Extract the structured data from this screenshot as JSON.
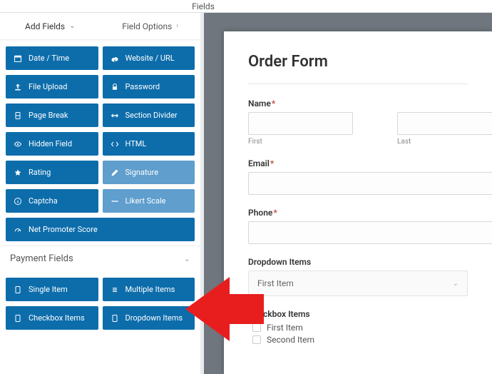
{
  "top": {
    "title": "Fields"
  },
  "tabs": {
    "add": "Add Fields",
    "options": "Field Options"
  },
  "fields": [
    {
      "icon": "cal",
      "label": "Date / Time"
    },
    {
      "icon": "link",
      "label": "Website / URL"
    },
    {
      "icon": "up",
      "label": "File Upload"
    },
    {
      "icon": "lock",
      "label": "Password"
    },
    {
      "icon": "page",
      "label": "Page Break"
    },
    {
      "icon": "div",
      "label": "Section Divider"
    },
    {
      "icon": "eye",
      "label": "Hidden Field"
    },
    {
      "icon": "code",
      "label": "HTML"
    },
    {
      "icon": "star",
      "label": "Rating"
    },
    {
      "icon": "pen",
      "label": "Signature"
    },
    {
      "icon": "info",
      "label": "Captcha"
    },
    {
      "icon": "lik",
      "label": "Likert Scale"
    },
    {
      "icon": "gauge",
      "label": "Net Promoter Score"
    }
  ],
  "section": {
    "payment": "Payment Fields"
  },
  "payment_fields": [
    {
      "icon": "doc",
      "label": "Single Item"
    },
    {
      "icon": "list",
      "label": "Multiple Items"
    },
    {
      "icon": "doc",
      "label": "Checkbox Items"
    },
    {
      "icon": "doc",
      "label": "Dropdown Items"
    }
  ],
  "form": {
    "title": "Order Form",
    "name_label": "Name",
    "first": "First",
    "last": "Last",
    "email_label": "Email",
    "phone_label": "Phone",
    "dropdown_label": "Dropdown Items",
    "dropdown_selected": "First Item",
    "checkbox_label": "Checkbox Items",
    "checkbox_items": [
      "First Item",
      "Second Item"
    ]
  }
}
